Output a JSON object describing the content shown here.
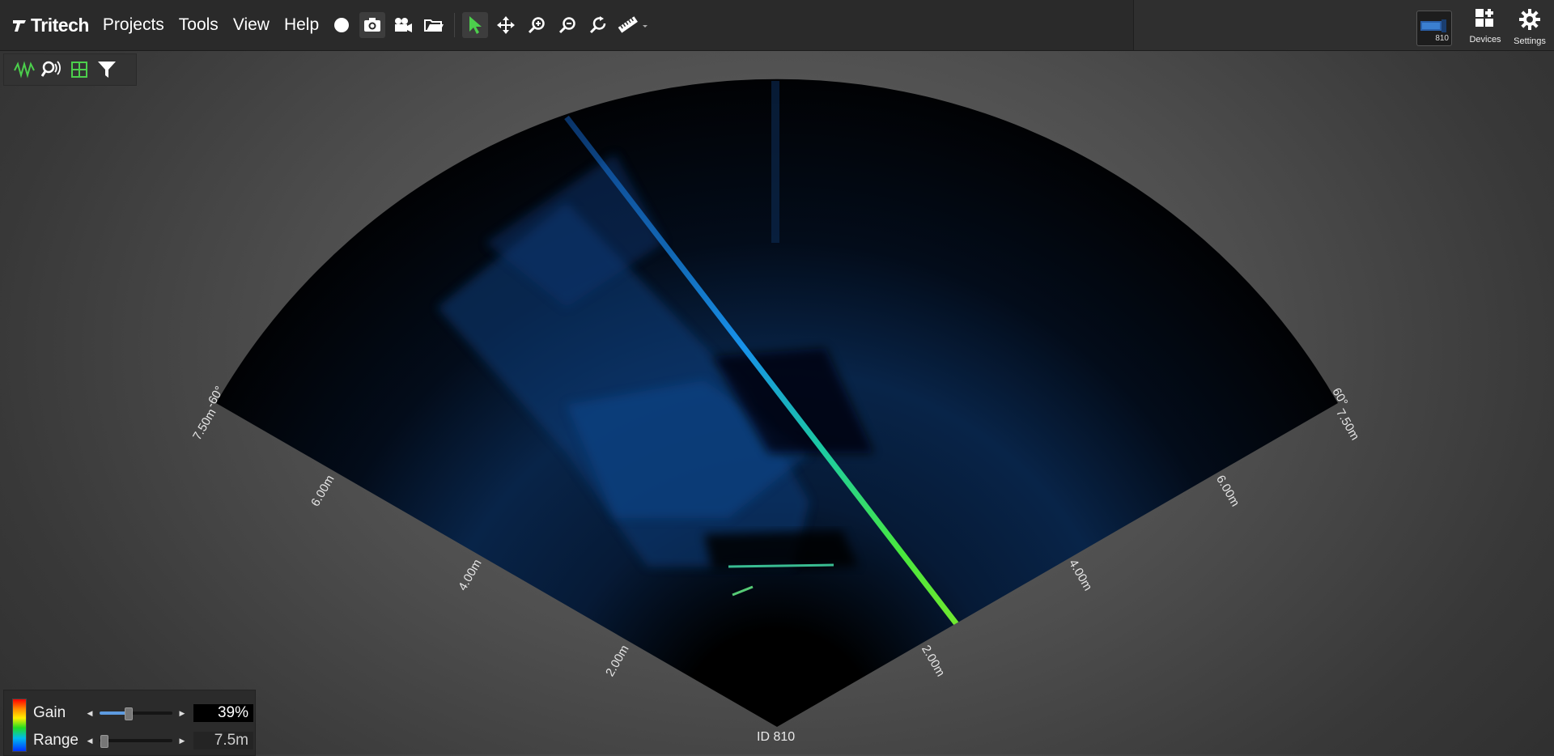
{
  "app": {
    "logo": "Tritech",
    "menu": [
      "Projects",
      "Tools",
      "View",
      "Help"
    ]
  },
  "toolbar_icons": [
    "record-icon",
    "snapshot-camera-icon",
    "video-camera-icon",
    "open-folder-icon",
    "select-pointer-icon",
    "pan-move-icon",
    "zoom-in-icon",
    "zoom-out-icon",
    "zoom-reset-icon",
    "measure-ruler-icon"
  ],
  "sub_toolbar_icons": [
    "waveform-icon",
    "search-sonar-icon",
    "grid-layout-icon",
    "filter-icon"
  ],
  "right_panel": {
    "device_thumb_label": "810",
    "devices_label": "Devices",
    "settings_label": "Settings"
  },
  "sonar": {
    "device_id": "ID 810",
    "left_edge_labels": [
      "7.50m",
      "6.00m",
      "4.00m",
      "2.00m"
    ],
    "right_edge_labels": [
      "7.50m",
      "6.00m",
      "4.00m",
      "2.00m"
    ],
    "left_angle_label": "-60°",
    "right_angle_label": "60°",
    "aperture_deg": 120,
    "max_range_m": 7.5
  },
  "controls": {
    "gain_label": "Gain",
    "gain_value": "39%",
    "gain_fraction": 0.39,
    "range_label": "Range",
    "range_value": "7.5m",
    "range_fraction": 0.05
  },
  "colors": {
    "accent_green": "#4ccf4c",
    "sonar_blue": "#1a8cff",
    "gain_fill": "#5d9be0"
  }
}
